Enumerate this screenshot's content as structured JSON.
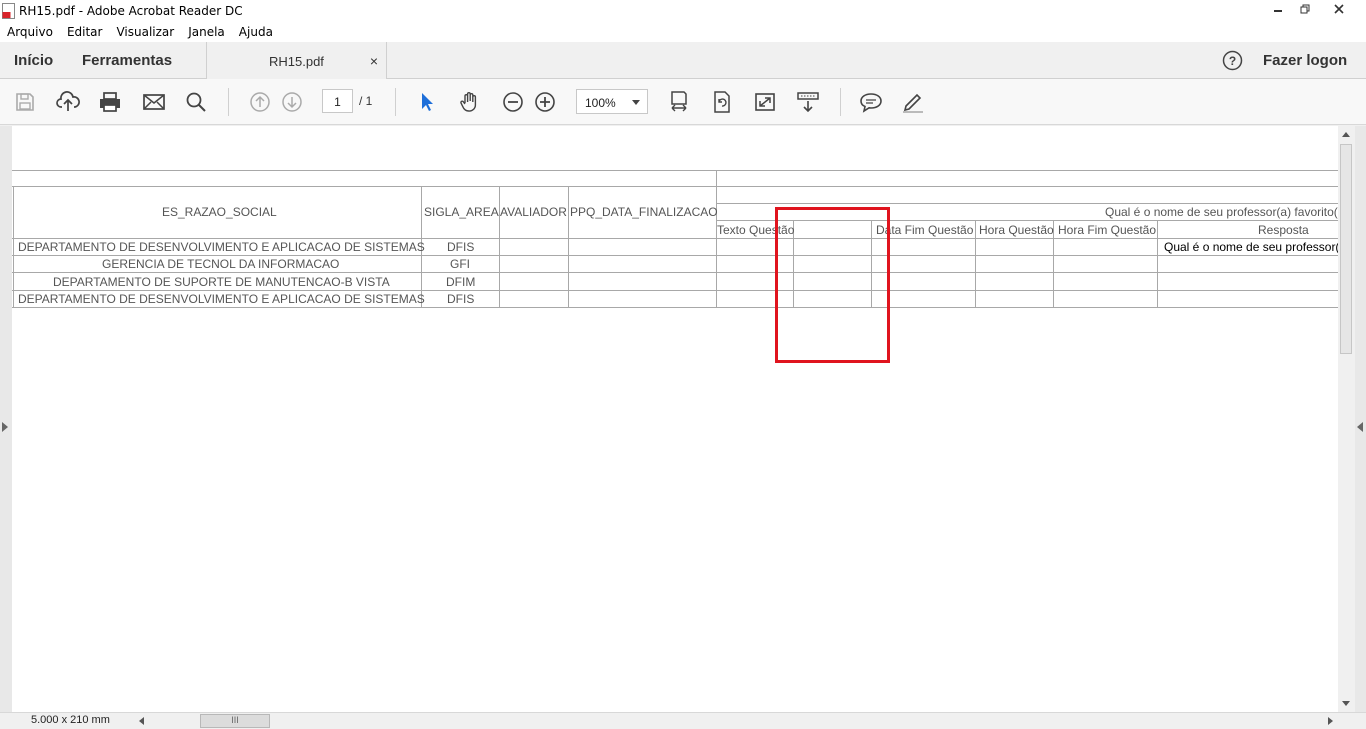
{
  "window": {
    "title": "RH15.pdf - Adobe Acrobat Reader DC"
  },
  "menu": [
    "Arquivo",
    "Editar",
    "Visualizar",
    "Janela",
    "Ajuda"
  ],
  "tabs": {
    "home": "Início",
    "tools": "Ferramentas",
    "document": "RH15.pdf",
    "close": "×",
    "logon": "Fazer logon"
  },
  "toolbar": {
    "page_current": "1",
    "page_total": "/ 1",
    "zoom": "100%",
    "icons": [
      "save-icon",
      "upload-icon",
      "print-icon",
      "email-icon",
      "search-icon",
      "page-up-icon",
      "page-down-icon",
      "select-cursor-icon",
      "hand-icon",
      "zoom-out-icon",
      "zoom-in-icon",
      "fit-page-icon",
      "rotate-icon",
      "fullscreen-icon",
      "scroll-mode-icon",
      "comment-icon",
      "highlight-icon"
    ]
  },
  "document": {
    "headers": {
      "razao": "ES_RAZAO_SOCIAL",
      "sigla": "SIGLA_AREA",
      "avaliador": "AVALIADOR",
      "data_final": "PPQ_DATA_FINALIZACAO",
      "question": "Qual é o nome de seu professor(a) favorito(a",
      "texto": "Texto Questão",
      "data_fim": "Data Fim Questão",
      "hora": "Hora Questão",
      "hora_fim": "Hora Fim Questão",
      "resposta": "Resposta"
    },
    "rows": [
      {
        "razao": "DEPARTAMENTO DE DESENVOLVIMENTO E APLICACAO DE SISTEMAS",
        "sigla": "DFIS",
        "resposta": "Qual é o nome de seu professor(a"
      },
      {
        "razao": "GERENCIA DE TECNOL DA INFORMACAO",
        "sigla": "GFI",
        "resposta": ""
      },
      {
        "razao": "DEPARTAMENTO DE SUPORTE DE MANUTENCAO-B VISTA",
        "sigla": "DFIM",
        "resposta": ""
      },
      {
        "razao": "DEPARTAMENTO DE DESENVOLVIMENTO E APLICACAO DE SISTEMAS",
        "sigla": "DFIS",
        "resposta": ""
      }
    ]
  },
  "status": {
    "page_size": "5.000 x 210 mm",
    "hthumb": "III"
  },
  "colors": {
    "highlight": "#e0141e",
    "accent": "#1e6fd9"
  }
}
